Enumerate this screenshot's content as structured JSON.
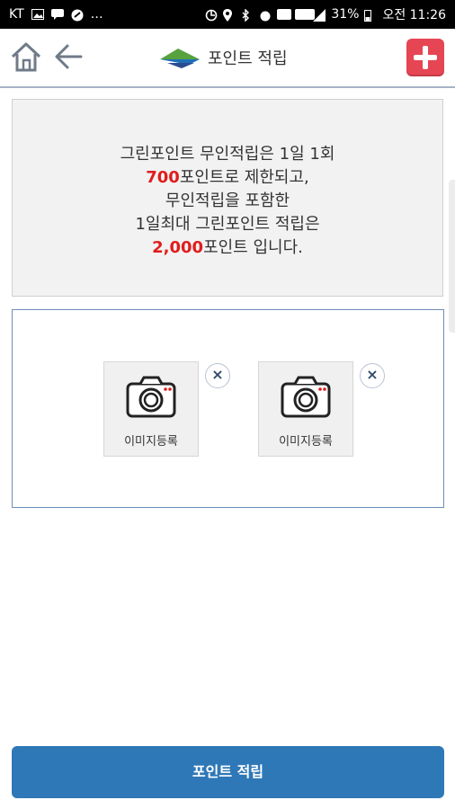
{
  "status_bar": {
    "carrier": "KT",
    "battery": "31%",
    "time": "오전 11:26"
  },
  "header": {
    "title": "포인트 적립"
  },
  "notice": {
    "line1": "그린포인트 무인적립은 1일 1회",
    "line2_red": "700",
    "line2_rest": "포인트로 제한되고,",
    "line3": "무인적립을 포함한",
    "line4": "1일최대 그린포인트 적립은",
    "line5_red": "2,000",
    "line5_rest": "포인트 입니다."
  },
  "upload": {
    "slots": [
      {
        "label": "이미지등록"
      },
      {
        "label": "이미지등록"
      }
    ],
    "close_symbol": "×"
  },
  "submit": {
    "label": "포인트 적립"
  },
  "colors": {
    "accent_red": "#e11c1c",
    "primary_blue": "#2e78b7",
    "add_button_red": "#e64553"
  }
}
